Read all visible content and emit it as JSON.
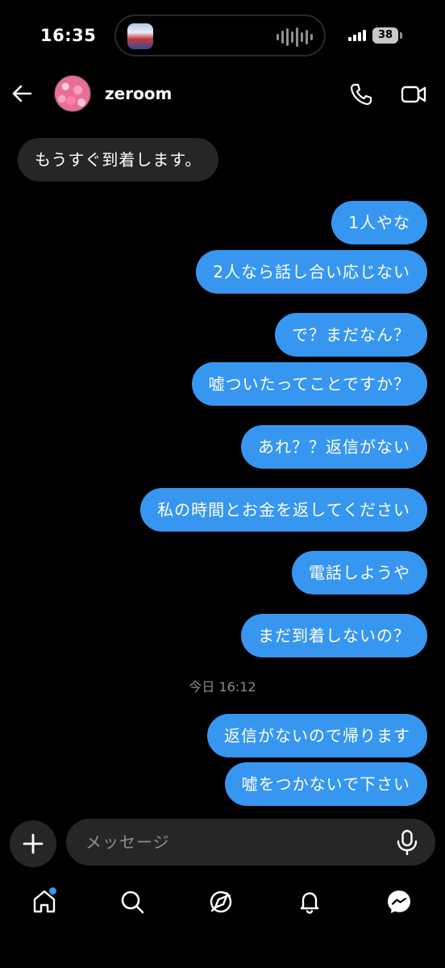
{
  "status_bar": {
    "time": "16:35",
    "battery": "38"
  },
  "header": {
    "contact_name": "zeroom"
  },
  "messages": [
    {
      "direction": "in",
      "text": "もうすぐ到着します。"
    },
    {
      "direction": "out",
      "text": "1人やな"
    },
    {
      "direction": "out",
      "text": "2人なら話し合い応じない"
    },
    {
      "direction": "out",
      "text": "で？まだなん？"
    },
    {
      "direction": "out",
      "text": "嘘ついたってことですか？"
    },
    {
      "direction": "out",
      "text": "あれ？？返信がない"
    },
    {
      "direction": "out",
      "text": "私の時間とお金を返してください"
    },
    {
      "direction": "out",
      "text": "電話しようや"
    },
    {
      "direction": "out",
      "text": "まだ到着しないの？"
    },
    {
      "direction": "out",
      "text": "返信がないので帰ります"
    },
    {
      "direction": "out",
      "text": "嘘をつかないで下さい"
    }
  ],
  "timestamp": "今日 16:12",
  "composer": {
    "placeholder": "メッセージ"
  },
  "colors": {
    "background": "#000000",
    "outgoing_bubble": "#3797f0",
    "incoming_bubble": "#262626",
    "notification_dot": "#3797f0"
  },
  "icons": {
    "header": [
      "back-arrow-icon",
      "phone-icon",
      "video-camera-icon"
    ],
    "composer": [
      "plus-icon",
      "microphone-icon"
    ],
    "nav": [
      "home-icon",
      "search-icon",
      "explore-icon",
      "heart-icon",
      "messenger-icon"
    ]
  }
}
